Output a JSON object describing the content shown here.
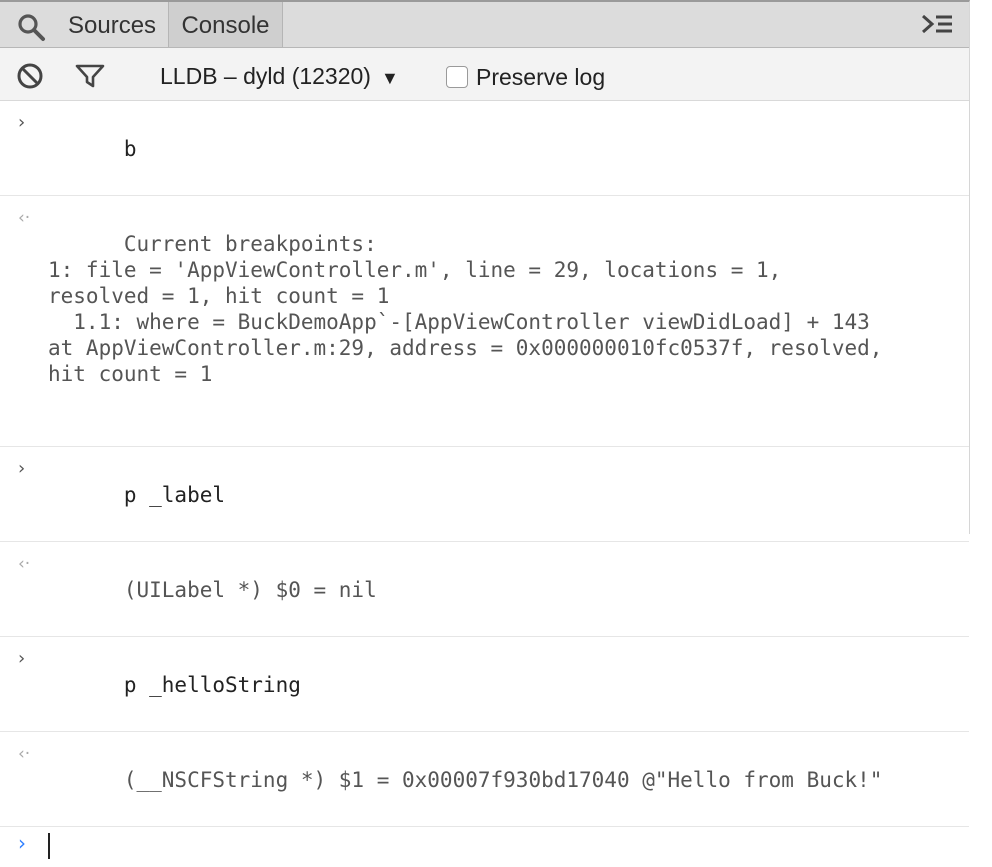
{
  "tabs": {
    "sources_label": "Sources",
    "console_label": "Console",
    "active": "Console"
  },
  "toolbar": {
    "context_label": "LLDB – dyld (12320)",
    "context_caret": "▼",
    "preserve_log_label": "Preserve log",
    "preserve_log_checked": false
  },
  "icons": {
    "search": "search-icon",
    "drawer_toggle": "drawer-toggle-icon",
    "clear": "clear-console-icon",
    "filter": "filter-icon"
  },
  "colors": {
    "prompt_accent": "#2f7fff",
    "tabbar_bg": "#dcdcdc",
    "toolbar_bg": "#f3f3f3"
  },
  "console": {
    "input_marker": "›",
    "output_marker": "‹·",
    "messages": [
      {
        "kind": "in",
        "text": "b"
      },
      {
        "kind": "out",
        "text": "Current breakpoints:\n1: file = 'AppViewController.m', line = 29, locations = 1,\nresolved = 1, hit count = 1\n  1.1: where = BuckDemoApp`-[AppViewController viewDidLoad] + 143\nat AppViewController.m:29, address = 0x000000010fc0537f, resolved,\nhit count = 1\n"
      },
      {
        "kind": "in",
        "text": "p _label"
      },
      {
        "kind": "out",
        "text": "(UILabel *) $0 = nil"
      },
      {
        "kind": "in",
        "text": "p _helloString"
      },
      {
        "kind": "out",
        "text": "(__NSCFString *) $1 = 0x00007f930bd17040 @\"Hello from Buck!\""
      }
    ],
    "prompt_marker": "›",
    "prompt_value": ""
  }
}
